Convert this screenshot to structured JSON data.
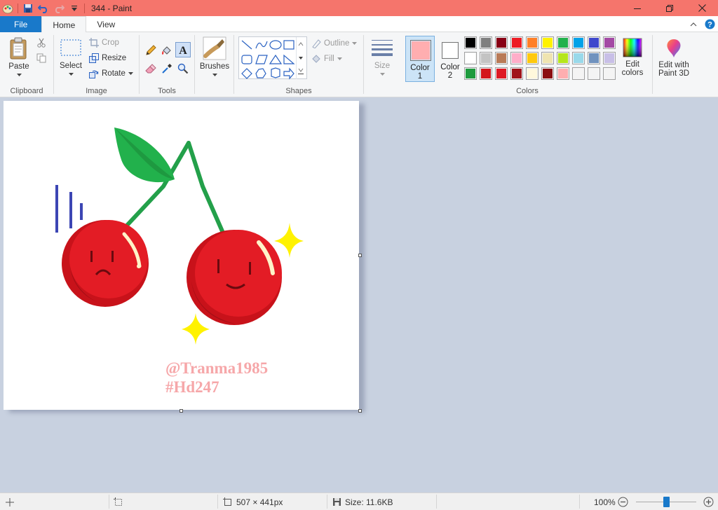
{
  "window": {
    "title": "344 - Paint",
    "title_bar_color": "#f5756c"
  },
  "tabs": [
    "File",
    "Home",
    "View"
  ],
  "clipboard": {
    "paste": "Paste",
    "label": "Clipboard"
  },
  "image": {
    "select": "Select",
    "crop": "Crop",
    "resize": "Resize",
    "rotate": "Rotate",
    "label": "Image"
  },
  "tools": {
    "label": "Tools",
    "brushes": "Brushes"
  },
  "shapes": {
    "outline": "Outline",
    "fill": "Fill",
    "label": "Shapes"
  },
  "size": {
    "label": "Size"
  },
  "colors": {
    "color1": "Color",
    "color1_num": "1",
    "color2": "Color",
    "color2_num": "2",
    "color1_value": "#ffaeb0",
    "color2_value": "#ffffff",
    "edit": "Edit",
    "edit2": "colors",
    "label": "Colors",
    "palette": [
      "#000000",
      "#7f7f7f",
      "#880015",
      "#ed1c24",
      "#ff7f27",
      "#fff200",
      "#22b14c",
      "#00a2e8",
      "#3f48cc",
      "#a349a4",
      "#ffffff",
      "#c3c3c3",
      "#b97a57",
      "#ffaec9",
      "#ffc90e",
      "#efe4b0",
      "#b5e61d",
      "#99d9ea",
      "#7092be",
      "#c8bfe7",
      "#1e9b3e",
      "#d3161c",
      "#de1a24",
      "#a0141a",
      "#fff8dc",
      "#8b0f12",
      "#ffaeb0",
      "#f4f4f4",
      "#f4f4f4",
      "#f4f4f4"
    ]
  },
  "paint3d": {
    "line1": "Edit with",
    "line2": "Paint 3D"
  },
  "canvas": {
    "watermark_line1": "@Tranma1985",
    "watermark_line2": "#Hd247"
  },
  "status": {
    "dimensions": "507 × 441px",
    "size": "Size: 11.6KB",
    "zoom": "100%"
  }
}
